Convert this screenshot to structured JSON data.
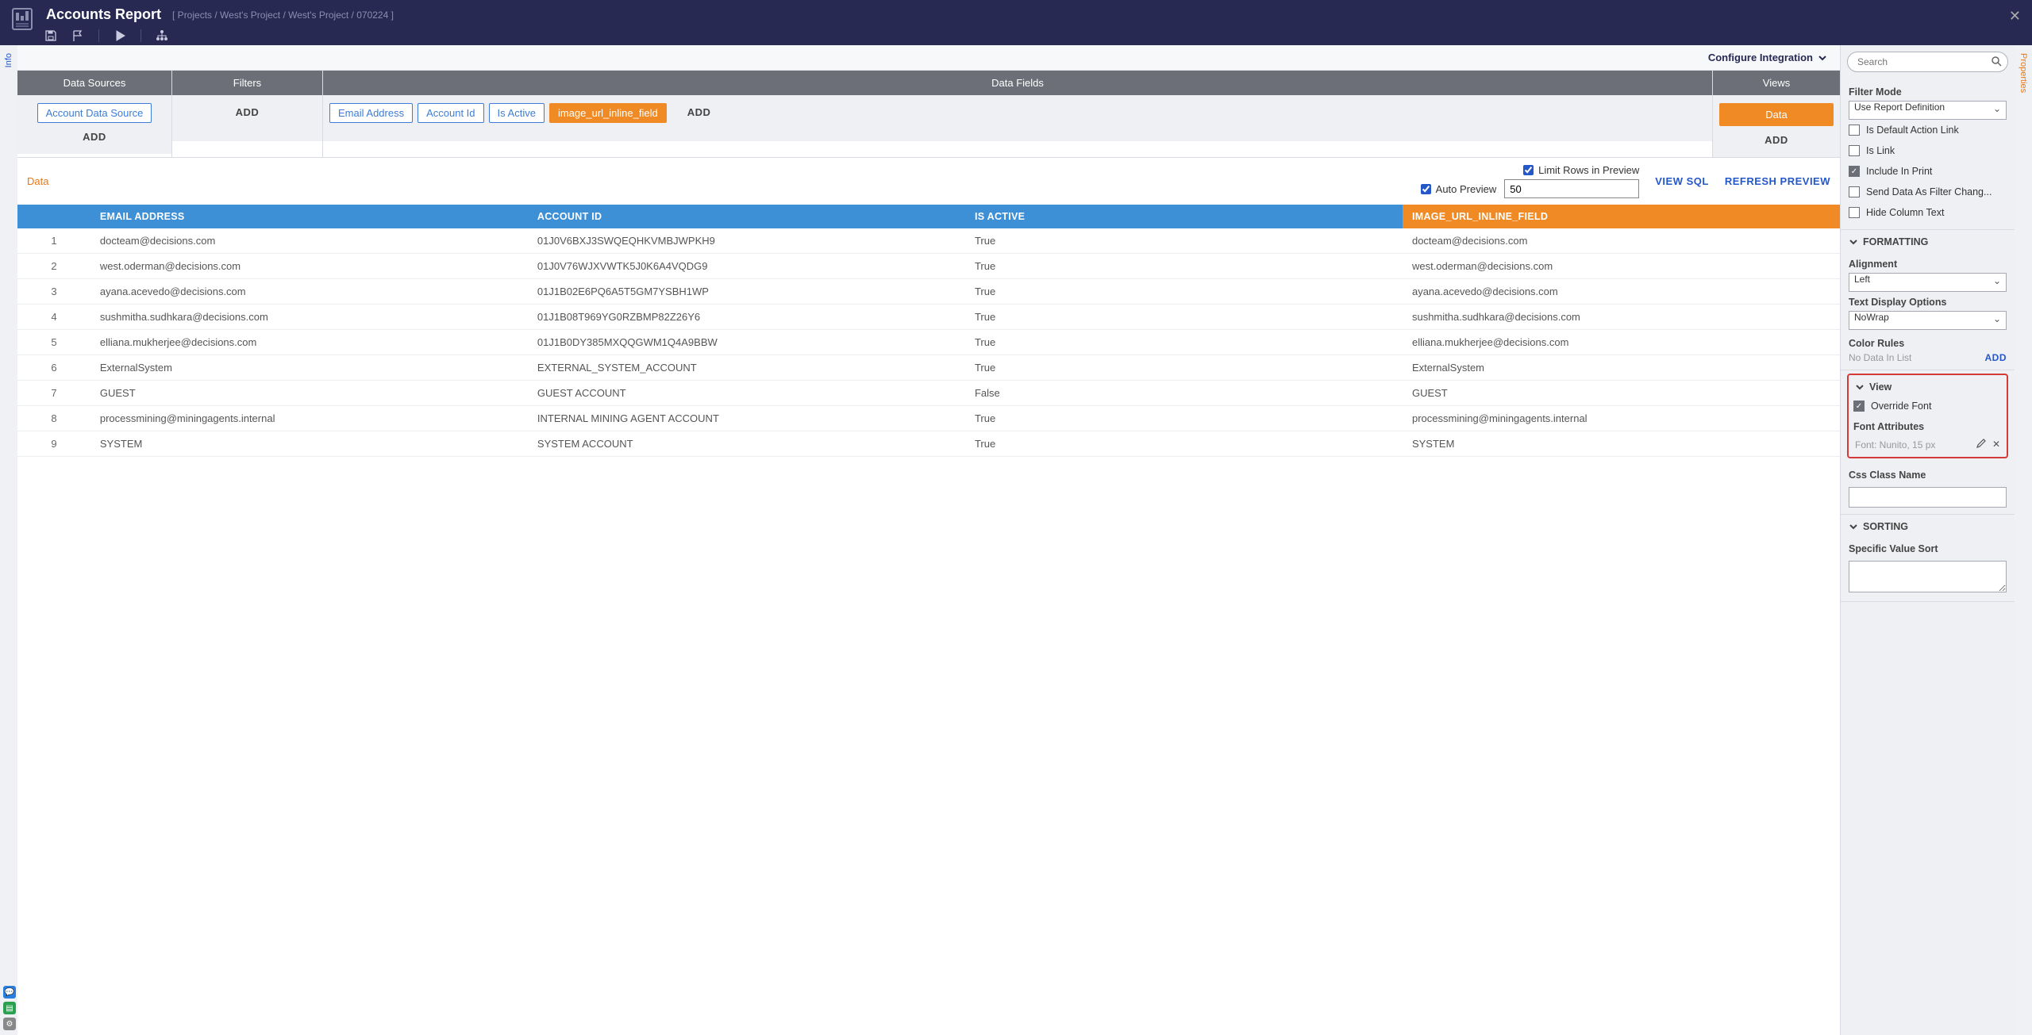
{
  "header": {
    "title": "Accounts Report",
    "breadcrumb": "[ Projects / West's Project / West's Project / 070224 ]"
  },
  "rails": {
    "left": "Info",
    "right": "Properties"
  },
  "configBar": {
    "configure": "Configure Integration"
  },
  "designer": {
    "cols": {
      "ds": {
        "head": "Data Sources",
        "chip": "Account Data Source",
        "add": "ADD"
      },
      "filters": {
        "head": "Filters",
        "add": "ADD"
      },
      "fields": {
        "head": "Data Fields",
        "chips": [
          "Email Address",
          "Account Id",
          "Is Active",
          "image_url_inline_field"
        ],
        "add": "ADD"
      },
      "views": {
        "head": "Views",
        "chip": "Data",
        "add": "ADD"
      }
    }
  },
  "previewBar": {
    "dataLabel": "Data",
    "limitRows": "Limit Rows in Preview",
    "autoPreview": "Auto Preview",
    "limitValue": "50",
    "viewSql": "VIEW SQL",
    "refresh": "REFRESH PREVIEW"
  },
  "table": {
    "headers": [
      "EMAIL ADDRESS",
      "ACCOUNT ID",
      "IS ACTIVE",
      "IMAGE_URL_INLINE_FIELD"
    ],
    "rows": [
      {
        "n": "1",
        "email": "docteam@decisions.com",
        "acct": "01J0V6BXJ3SWQEQHKVMBJWPKH9",
        "active": "True",
        "img": "docteam@decisions.com"
      },
      {
        "n": "2",
        "email": "west.oderman@decisions.com",
        "acct": "01J0V76WJXVWTK5J0K6A4VQDG9",
        "active": "True",
        "img": "west.oderman@decisions.com"
      },
      {
        "n": "3",
        "email": "ayana.acevedo@decisions.com",
        "acct": "01J1B02E6PQ6A5T5GM7YSBH1WP",
        "active": "True",
        "img": "ayana.acevedo@decisions.com"
      },
      {
        "n": "4",
        "email": "sushmitha.sudhkara@decisions.com",
        "acct": "01J1B08T969YG0RZBMP82Z26Y6",
        "active": "True",
        "img": "sushmitha.sudhkara@decisions.com"
      },
      {
        "n": "5",
        "email": "elliana.mukherjee@decisions.com",
        "acct": "01J1B0DY385MXQQGWM1Q4A9BBW",
        "active": "True",
        "img": "elliana.mukherjee@decisions.com"
      },
      {
        "n": "6",
        "email": "ExternalSystem",
        "acct": "EXTERNAL_SYSTEM_ACCOUNT",
        "active": "True",
        "img": "ExternalSystem"
      },
      {
        "n": "7",
        "email": "GUEST",
        "acct": "GUEST ACCOUNT",
        "active": "False",
        "img": "GUEST"
      },
      {
        "n": "8",
        "email": "processmining@miningagents.internal",
        "acct": "INTERNAL MINING AGENT ACCOUNT",
        "active": "True",
        "img": "processmining@miningagents.internal"
      },
      {
        "n": "9",
        "email": "SYSTEM",
        "acct": "SYSTEM ACCOUNT",
        "active": "True",
        "img": "SYSTEM"
      }
    ]
  },
  "props": {
    "searchPlaceholder": "Search",
    "filterMode": {
      "label": "Filter Mode",
      "value": "Use Report Definition"
    },
    "checks": {
      "defaultAction": "Is Default Action Link",
      "isLink": "Is Link",
      "includePrint": "Include In Print",
      "sendFilter": "Send Data As Filter Chang...",
      "hideCol": "Hide Column Text"
    },
    "formatting": {
      "head": "FORMATTING",
      "alignment": {
        "label": "Alignment",
        "value": "Left"
      },
      "textDisplay": {
        "label": "Text Display Options",
        "value": "NoWrap"
      },
      "colorRules": {
        "label": "Color Rules",
        "nodata": "No Data In List",
        "add": "ADD"
      }
    },
    "view": {
      "head": "View",
      "override": "Override Font",
      "fontAttrsLabel": "Font Attributes",
      "fontAttrsValue": "Font: Nunito, 15 px",
      "cssClass": "Css Class Name"
    },
    "sorting": {
      "head": "SORTING",
      "specific": "Specific Value Sort"
    }
  }
}
